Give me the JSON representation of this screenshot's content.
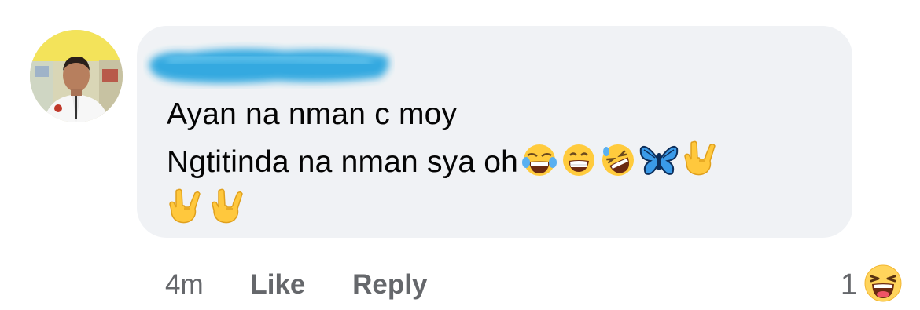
{
  "comment": {
    "author_name": "",
    "line1": "Ayan na nman c moy",
    "line2": "Ngtitinda na nman sya oh",
    "line2_emojis": [
      "face-with-tears-of-joy-icon",
      "grinning-face-icon",
      "rolling-on-floor-laughing-icon",
      "butterfly-icon",
      "love-you-gesture-icon"
    ],
    "line3_emojis": [
      "love-you-gesture-icon",
      "love-you-gesture-icon"
    ]
  },
  "actions": {
    "time": "4m",
    "like_label": "Like",
    "reply_label": "Reply"
  },
  "reactions": {
    "count": "1",
    "icon": "haha-reaction-icon"
  }
}
